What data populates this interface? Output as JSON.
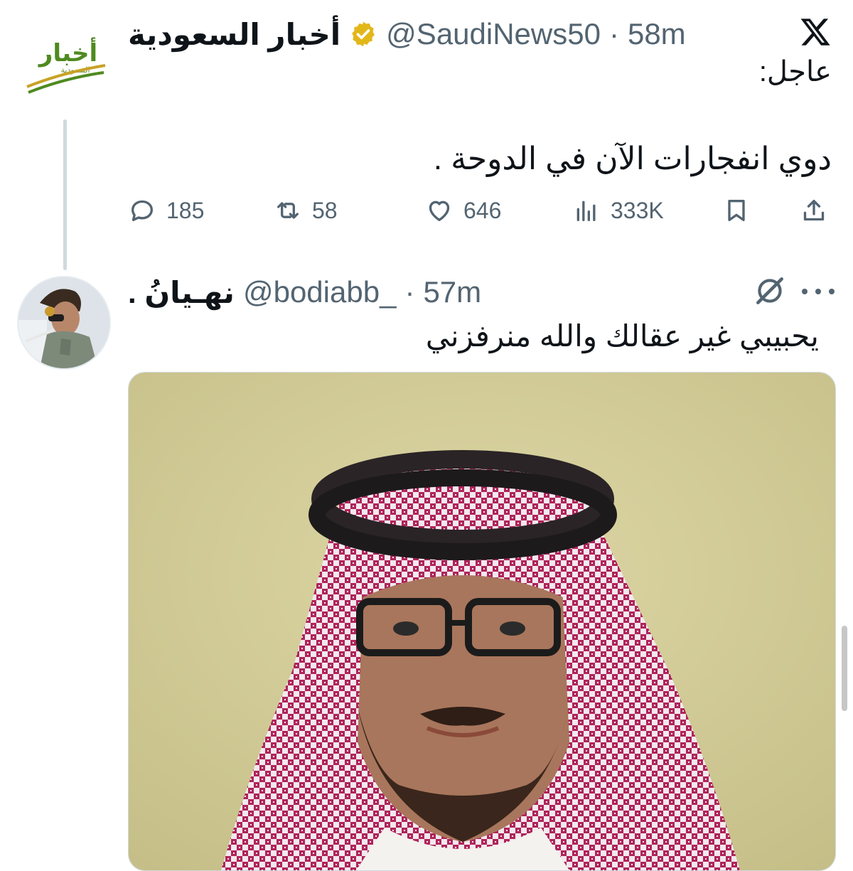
{
  "tweet1": {
    "display_name": "أخبار السعودية",
    "handle": "@SaudiNews50",
    "separator": "·",
    "time": "58m",
    "logo_text": "أخبار",
    "logo_subtext": "السعودية",
    "text_line1": "عاجل:",
    "text_line2": "دوي انفجارات الآن في الدوحة .",
    "replies": "185",
    "reposts": "58",
    "likes": "646",
    "views": "333K"
  },
  "tweet2": {
    "display_name": "نهـيانُ .",
    "handle": "@bodiabb_",
    "separator": "·",
    "time": "57m",
    "text": "يحبيبي غير عقالك والله منرفزني"
  },
  "icons": {
    "x_logo": "x-logo-icon",
    "verified": "verified-badge-icon",
    "reply": "reply-icon",
    "repost": "repost-icon",
    "like": "heart-icon",
    "views": "views-chart-icon",
    "bookmark": "bookmark-icon",
    "share": "share-icon",
    "grok": "grok-icon",
    "more": "more-dots-icon"
  },
  "colors": {
    "text_primary": "#0f1419",
    "text_secondary": "#536471",
    "verified_gold": "#e2b719",
    "divider": "#cfd9de",
    "logo_green": "#4f8a1f"
  }
}
